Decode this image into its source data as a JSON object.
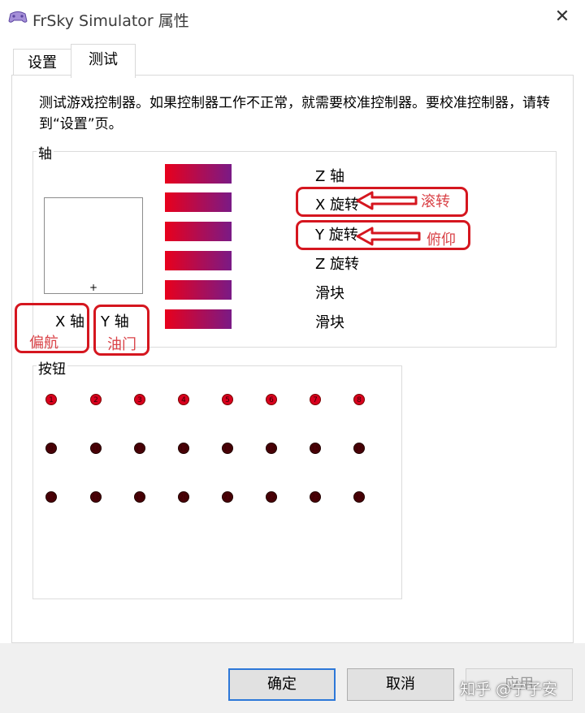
{
  "window": {
    "title": "FrSky Simulator 属性",
    "close_glyph": "✕",
    "icon": "gamepad-icon"
  },
  "tabs": [
    {
      "label": "设置",
      "selected": false
    },
    {
      "label": "测试",
      "selected": true
    }
  ],
  "description": "测试游戏控制器。如果控制器工作不正常，就需要校准控制器。要校准控制器，请转到“设置”页。",
  "axes": {
    "group_label": "轴",
    "crosshair": "+",
    "x_label": "X 轴",
    "y_label": "Y 轴",
    "items": [
      {
        "label": "Z 轴"
      },
      {
        "label": "X 旋转"
      },
      {
        "label": "Y 旋转"
      },
      {
        "label": "Z 旋转"
      },
      {
        "label": "滑块"
      },
      {
        "label": "滑块"
      }
    ],
    "bar_colors": [
      "#e8001c",
      "#7a1a86"
    ]
  },
  "annotations": {
    "x_rotation": "滚转",
    "y_rotation": "俯仰",
    "x_axis": "偏航",
    "y_axis": "油门",
    "color": "#d5161f"
  },
  "buttons": {
    "group_label": "按钮",
    "rows": [
      [
        "1",
        "2",
        "3",
        "4",
        "5",
        "6",
        "7",
        "8"
      ],
      [
        "9",
        "10",
        "11",
        "12",
        "13",
        "14",
        "15",
        "16"
      ],
      [
        "17",
        "18",
        "19",
        "20",
        "21",
        "22",
        "23",
        "24"
      ]
    ]
  },
  "footer": {
    "ok": "确定",
    "cancel": "取消",
    "apply": "应用",
    "watermark": "知乎 @宁子安"
  }
}
